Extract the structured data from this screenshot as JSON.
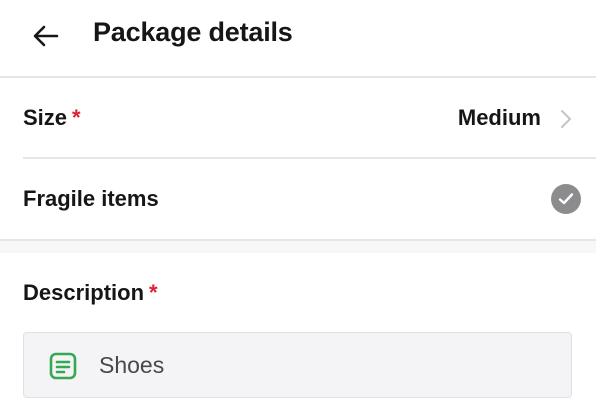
{
  "header": {
    "title": "Package details",
    "back_icon": "arrow-left-icon"
  },
  "size_row": {
    "label": "Size",
    "required_mark": "*",
    "value": "Medium",
    "chevron_icon": "chevron-right-icon"
  },
  "fragile_row": {
    "label": "Fragile items",
    "checked": true,
    "check_icon": "check-circle-icon"
  },
  "description": {
    "label": "Description",
    "required_mark": "*",
    "value": "Shoes",
    "icon": "note-icon"
  },
  "colors": {
    "required": "#e0202e",
    "note_icon": "#34a853",
    "check_circle": "#8c8c8e"
  }
}
